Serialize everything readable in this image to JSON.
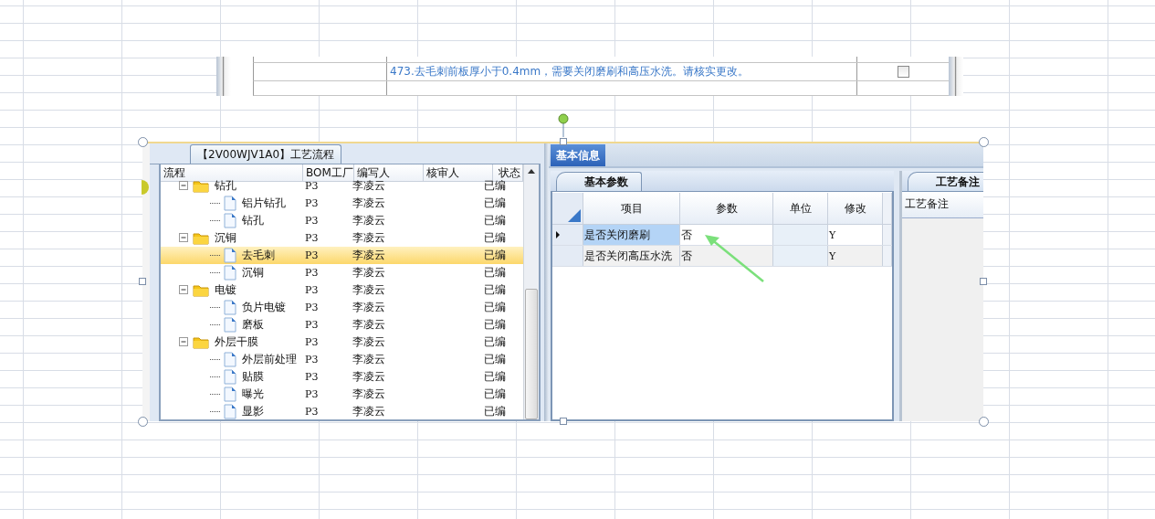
{
  "notes_strip": {
    "rows": [
      {
        "text": "473.去毛刺前板厚小于0.4mm，需要关闭磨刷和高压水洗。请核实更改。",
        "checked": false
      }
    ]
  },
  "process_panel": {
    "title": "【2V00WJV1A0】工艺流程",
    "columns": [
      "流程",
      "BOM工厂",
      "编写人",
      "核审人",
      "状态"
    ],
    "tree": [
      {
        "name": "钻孔",
        "kind": "folder",
        "expanded": true,
        "selected": false,
        "bom": "P3",
        "writer": "李凌云",
        "status": "已编",
        "children": [
          {
            "name": "铝片钻孔",
            "kind": "step",
            "selected": false,
            "bom": "P3",
            "writer": "李凌云",
            "status": "已编"
          },
          {
            "name": "钻孔",
            "kind": "step",
            "selected": false,
            "bom": "P3",
            "writer": "李凌云",
            "status": "已编"
          }
        ]
      },
      {
        "name": "沉铜",
        "kind": "folder",
        "expanded": true,
        "selected": false,
        "bom": "P3",
        "writer": "李凌云",
        "status": "已编",
        "children": [
          {
            "name": "去毛刺",
            "kind": "step",
            "selected": true,
            "bom": "P3",
            "writer": "李凌云",
            "status": "已编"
          },
          {
            "name": "沉铜",
            "kind": "step",
            "selected": false,
            "bom": "P3",
            "writer": "李凌云",
            "status": "已编"
          }
        ]
      },
      {
        "name": "电镀",
        "kind": "folder",
        "expanded": true,
        "selected": false,
        "bom": "P3",
        "writer": "李凌云",
        "status": "已编",
        "children": [
          {
            "name": "负片电镀",
            "kind": "step",
            "selected": false,
            "bom": "P3",
            "writer": "李凌云",
            "status": "已编"
          },
          {
            "name": "磨板",
            "kind": "step",
            "selected": false,
            "bom": "P3",
            "writer": "李凌云",
            "status": "已编"
          }
        ]
      },
      {
        "name": "外层干膜",
        "kind": "folder",
        "expanded": true,
        "selected": false,
        "bom": "P3",
        "writer": "李凌云",
        "status": "已编",
        "children": [
          {
            "name": "外层前处理",
            "kind": "step",
            "selected": false,
            "bom": "P3",
            "writer": "李凌云",
            "status": "已编"
          },
          {
            "name": "贴膜",
            "kind": "step",
            "selected": false,
            "bom": "P3",
            "writer": "李凌云",
            "status": "已编"
          },
          {
            "name": "曝光",
            "kind": "step",
            "selected": false,
            "bom": "P3",
            "writer": "李凌云",
            "status": "已编"
          },
          {
            "name": "显影",
            "kind": "step",
            "selected": false,
            "bom": "P3",
            "writer": "李凌云",
            "status": "已编"
          }
        ]
      }
    ]
  },
  "info_panel": {
    "tabs": [
      {
        "label": "基本信息",
        "selected": true
      }
    ],
    "sub_tab": "基本参数",
    "columns": [
      "项目",
      "参数",
      "单位",
      "修改"
    ],
    "rows": [
      {
        "item": "是否关闭磨刷",
        "value": "否",
        "modified": "Y",
        "selected": true
      },
      {
        "item": "是否关闭高压水洗",
        "value": "否",
        "modified": "Y",
        "selected": false
      }
    ]
  },
  "remarks_panel": {
    "tab": "工艺备注",
    "header": "工艺备注"
  }
}
